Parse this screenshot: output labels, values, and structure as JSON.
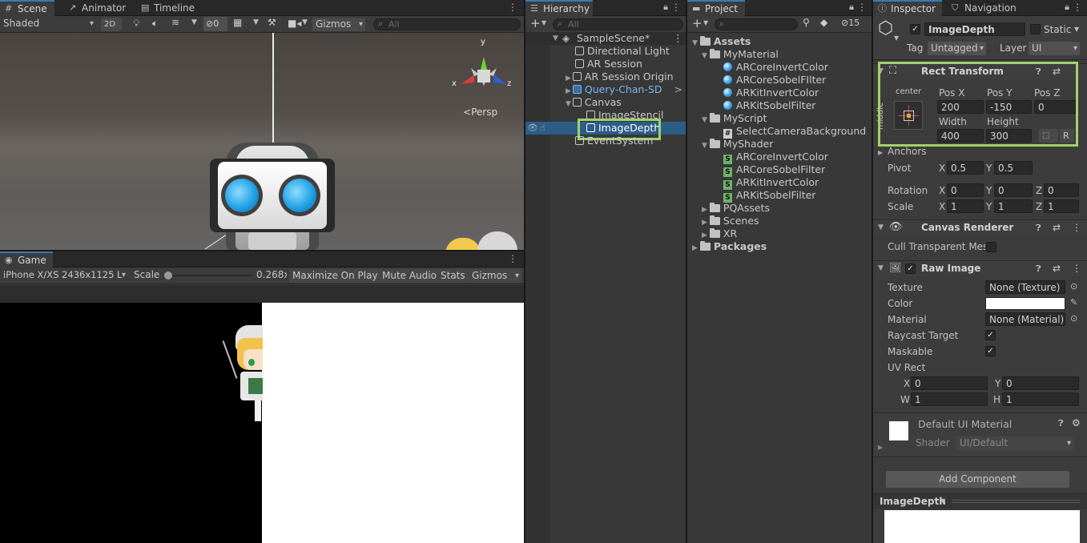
{
  "scene": {
    "tabs": [
      "Scene",
      "Animator",
      "Timeline"
    ],
    "shading": "Shaded",
    "mode_2d": "2D",
    "hidden_count": "0",
    "gizmos": "Gizmos",
    "search_placeholder": "All",
    "persp": "Persp",
    "axis_x": "x",
    "axis_y": "y",
    "axis_z": "z"
  },
  "game": {
    "tab": "Game",
    "resolution": "iPhone X/XS 2436x1125 L",
    "scale_label": "Scale",
    "scale_value": "0.268x",
    "scale_fraction": 0.04,
    "maximize": "Maximize On Play",
    "mute": "Mute Audio",
    "stats": "Stats",
    "gizmos": "Gizmos"
  },
  "hierarchy": {
    "tab": "Hierarchy",
    "search_placeholder": "All",
    "items": [
      {
        "label": "SampleScene*",
        "indent": 0,
        "type": "scene"
      },
      {
        "label": "Directional Light",
        "indent": 1,
        "type": "go"
      },
      {
        "label": "AR Session",
        "indent": 1,
        "type": "go"
      },
      {
        "label": "AR Session Origin",
        "indent": 1,
        "type": "go-arrow"
      },
      {
        "label": "Query-Chan-SD",
        "indent": 1,
        "type": "prefab"
      },
      {
        "label": "Canvas",
        "indent": 1,
        "type": "go-open"
      },
      {
        "label": "ImageStencil",
        "indent": 2,
        "type": "go"
      },
      {
        "label": "ImageDepth",
        "indent": 2,
        "type": "selected"
      },
      {
        "label": "EventSystem",
        "indent": 1,
        "type": "go"
      }
    ]
  },
  "project": {
    "tab": "Project",
    "hidden_count": "15",
    "items": [
      {
        "label": "Assets",
        "indent": 0,
        "type": "folder-open",
        "bold": true
      },
      {
        "label": "MyMaterial",
        "indent": 1,
        "type": "folder-open"
      },
      {
        "label": "ARCoreInvertColor",
        "indent": 2,
        "type": "mat"
      },
      {
        "label": "ARCoreSobelFIlter",
        "indent": 2,
        "type": "mat"
      },
      {
        "label": "ARKitInvertColor",
        "indent": 2,
        "type": "mat"
      },
      {
        "label": "ARKitSobelFilter",
        "indent": 2,
        "type": "mat"
      },
      {
        "label": "MyScript",
        "indent": 1,
        "type": "folder-open"
      },
      {
        "label": "SelectCameraBackground",
        "indent": 2,
        "type": "script"
      },
      {
        "label": "MyShader",
        "indent": 1,
        "type": "folder-open"
      },
      {
        "label": "ARCoreInvertColor",
        "indent": 2,
        "type": "shader"
      },
      {
        "label": "ARCoreSobelFilter",
        "indent": 2,
        "type": "shader"
      },
      {
        "label": "ARKitInvertColor",
        "indent": 2,
        "type": "shader"
      },
      {
        "label": "ARKitSobelFilter",
        "indent": 2,
        "type": "shader"
      },
      {
        "label": "PQAssets",
        "indent": 1,
        "type": "folder"
      },
      {
        "label": "Scenes",
        "indent": 1,
        "type": "folder"
      },
      {
        "label": "XR",
        "indent": 1,
        "type": "folder"
      },
      {
        "label": "Packages",
        "indent": 0,
        "type": "folder",
        "bold": true
      }
    ]
  },
  "inspector": {
    "tabs": [
      "Inspector",
      "Navigation"
    ],
    "object_name": "ImageDepth",
    "static_label": "Static",
    "tag_label": "Tag",
    "tag_value": "Untagged",
    "layer_label": "Layer",
    "layer_value": "UI",
    "rect": {
      "title": "Rect Transform",
      "anchor_h": "center",
      "anchor_v": "middle",
      "posx_label": "Pos X",
      "posx": "200",
      "posy_label": "Pos Y",
      "posy": "-150",
      "posz_label": "Pos Z",
      "posz": "0",
      "width_label": "Width",
      "width": "400",
      "height_label": "Height",
      "height": "300",
      "r_label": "R",
      "anchors": "Anchors",
      "pivot": "Pivot",
      "pivot_x": "0.5",
      "pivot_y": "0.5",
      "rotation": "Rotation",
      "rot_x": "0",
      "rot_y": "0",
      "rot_z": "0",
      "scale": "Scale",
      "scale_x": "1",
      "scale_y": "1",
      "scale_z": "1",
      "x": "X",
      "y": "Y",
      "z": "Z"
    },
    "canvas_renderer": {
      "title": "Canvas Renderer",
      "cull": "Cull Transparent Mes"
    },
    "raw_image": {
      "title": "Raw Image",
      "texture_label": "Texture",
      "texture": "None (Texture)",
      "color_label": "Color",
      "material_label": "Material",
      "material": "None (Material)",
      "raycast": "Raycast Target",
      "maskable": "Maskable",
      "uvrect": "UV Rect",
      "x": "X",
      "xv": "0",
      "y": "Y",
      "yv": "0",
      "w": "W",
      "wv": "1",
      "h": "H",
      "hv": "1"
    },
    "material": {
      "title": "Default UI Material",
      "shader_label": "Shader",
      "shader": "UI/Default"
    },
    "add_component": "Add Component",
    "preview_title": "ImageDepth"
  },
  "colors": {
    "highlight": "#9fd26b",
    "selection": "#2c5d87",
    "accent": "#3a79bb"
  }
}
